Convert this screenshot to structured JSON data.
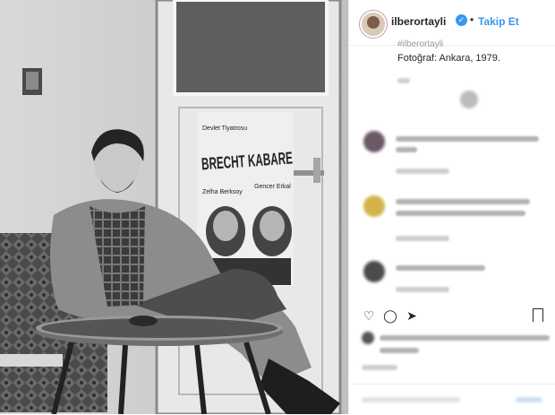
{
  "post": {
    "username": "ilberortayli",
    "verified_mark": "✓",
    "separator": "•",
    "follow_label": "Takip Et",
    "caption_user": "#ilberortayli",
    "caption_text": "Fotoğraf: Ankara, 1979.",
    "poster_top": "Devlet Tiyatrosu",
    "poster_title": "BRECHT KABARE",
    "poster_left": "Zelha Berksoy",
    "poster_right": "Gencer Erkal"
  },
  "icons": {
    "verified": "verified-badge-icon",
    "like": "heart-icon",
    "comment": "comment-icon",
    "share": "share-icon",
    "save": "bookmark-icon"
  },
  "colors": {
    "link_blue": "#3897f0",
    "text_dark": "#262626",
    "border": "#efefef"
  }
}
